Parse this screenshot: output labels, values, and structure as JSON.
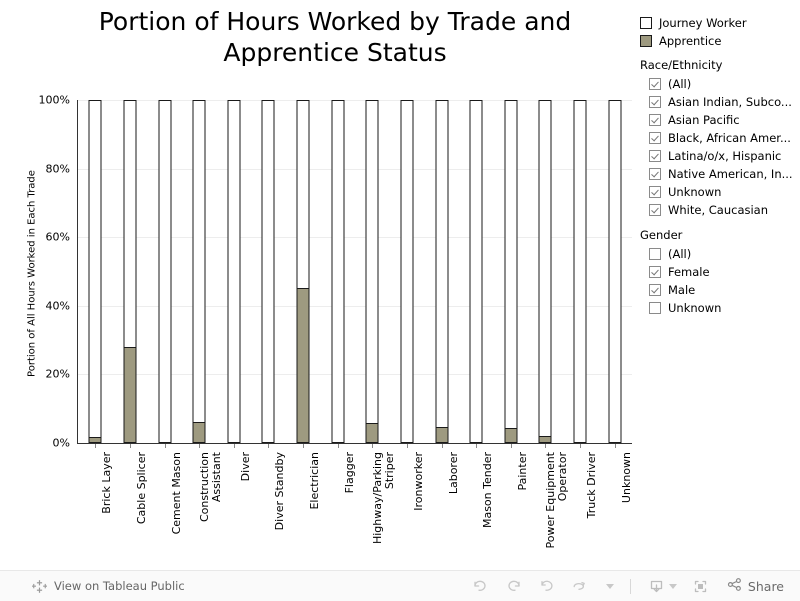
{
  "chart_data": {
    "type": "bar",
    "title": "Portion of Hours Worked by Trade and Apprentice Status",
    "title_line1": "Portion of Hours Worked by Trade and",
    "title_line2": "Apprentice Status",
    "xlabel": "",
    "ylabel": "Portion of All Hours Worked in Each Trade",
    "ylim": [
      0,
      100
    ],
    "ytick_labels": [
      "0%",
      "20%",
      "40%",
      "60%",
      "80%",
      "100%"
    ],
    "ytick_values": [
      0,
      20,
      40,
      60,
      80,
      100
    ],
    "grid": true,
    "legend_position": "right",
    "stacked": true,
    "categories": [
      "Brick Layer",
      "Cable Splicer",
      "Cement Mason",
      "Construction Assistant",
      "Diver",
      "Diver Standby",
      "Electrician",
      "Flagger",
      "Highway/Parking Striper",
      "Ironworker",
      "Laborer",
      "Mason Tender",
      "Painter",
      "Power Equipment Operator",
      "Truck Driver",
      "Unknown"
    ],
    "category_lines": [
      [
        "Brick Layer"
      ],
      [
        "Cable Splicer"
      ],
      [
        "Cement Mason"
      ],
      [
        "Construction",
        "Assistant"
      ],
      [
        "Diver"
      ],
      [
        "Diver Standby"
      ],
      [
        "Electrician"
      ],
      [
        "Flagger"
      ],
      [
        "Highway/Parking",
        "Striper"
      ],
      [
        "Ironworker"
      ],
      [
        "Laborer"
      ],
      [
        "Mason Tender"
      ],
      [
        "Painter"
      ],
      [
        "Power Equipment",
        "Operator"
      ],
      [
        "Truck Driver"
      ],
      [
        "Unknown"
      ]
    ],
    "series": [
      {
        "name": "Apprentice",
        "color": "#9e9a80",
        "values": [
          1.5,
          27.8,
          0,
          5.8,
          0,
          0,
          45.0,
          0,
          5.5,
          0,
          4.5,
          0,
          4.0,
          1.7,
          0,
          0
        ]
      },
      {
        "name": "Journey Worker",
        "color": "#ffffff",
        "values": [
          98.5,
          72.2,
          100,
          94.2,
          100,
          100,
          55.0,
          100,
          94.5,
          100,
          95.5,
          100,
          96.0,
          98.3,
          100,
          100
        ]
      }
    ]
  },
  "legend": {
    "entries": [
      {
        "label": "Journey Worker",
        "color": "#ffffff"
      },
      {
        "label": "Apprentice",
        "color": "#9e9a80"
      }
    ]
  },
  "filters": [
    {
      "title": "Race/Ethnicity",
      "options": [
        {
          "label": "(All)",
          "checked": true
        },
        {
          "label": "Asian Indian, Subco...",
          "checked": true
        },
        {
          "label": "Asian Pacific",
          "checked": true
        },
        {
          "label": "Black, African Amer...",
          "checked": true
        },
        {
          "label": "Latina/o/x, Hispanic",
          "checked": true
        },
        {
          "label": "Native American, In...",
          "checked": true
        },
        {
          "label": "Unknown",
          "checked": true
        },
        {
          "label": "White, Caucasian",
          "checked": true
        }
      ]
    },
    {
      "title": "Gender",
      "options": [
        {
          "label": "(All)",
          "checked": false
        },
        {
          "label": "Female",
          "checked": true
        },
        {
          "label": "Male",
          "checked": true
        },
        {
          "label": "Unknown",
          "checked": false
        }
      ]
    }
  ],
  "toolbar": {
    "tableau_link": "View on Tableau Public",
    "share_label": "Share",
    "buttons": [
      "undo-icon",
      "redo-icon",
      "revert-icon",
      "refresh-icon",
      "pause-icon",
      "download-icon",
      "fullscreen-icon",
      "share-icon"
    ]
  }
}
